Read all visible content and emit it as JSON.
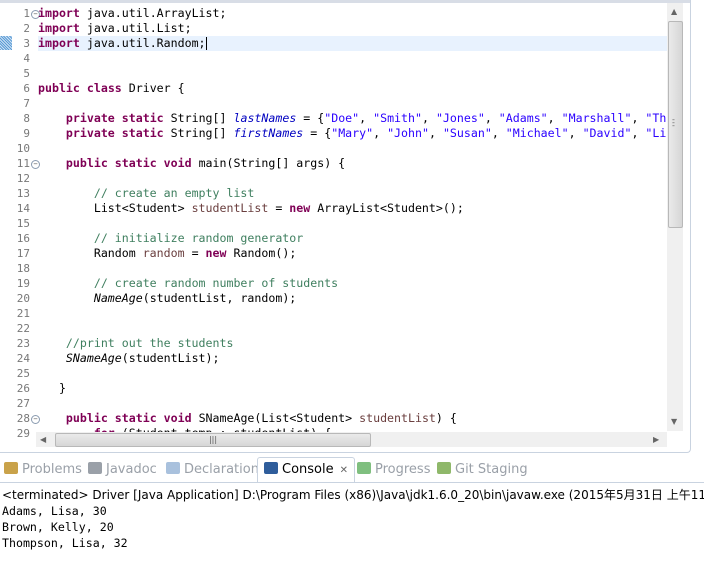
{
  "editor": {
    "line_numbers": [
      "1",
      "2",
      "3",
      "4",
      "5",
      "6",
      "7",
      "8",
      "9",
      "10",
      "11",
      "12",
      "13",
      "14",
      "15",
      "16",
      "17",
      "18",
      "19",
      "20",
      "21",
      "22",
      "23",
      "24",
      "25",
      "26",
      "27",
      "28",
      "29"
    ],
    "lines": [
      [
        [
          "k",
          "import"
        ],
        [
          "t",
          " java.util.ArrayList;"
        ]
      ],
      [
        [
          "k",
          "import"
        ],
        [
          "t",
          " java.util.List;"
        ]
      ],
      [
        [
          "k",
          "import"
        ],
        [
          "t",
          " java.util.Random;"
        ]
      ],
      [],
      [],
      [
        [
          "k",
          "public"
        ],
        [
          "t",
          " "
        ],
        [
          "k",
          "class"
        ],
        [
          "t",
          " Driver {"
        ]
      ],
      [],
      [
        [
          "t",
          "    "
        ],
        [
          "k",
          "private"
        ],
        [
          "t",
          " "
        ],
        [
          "k",
          "static"
        ],
        [
          "t",
          " String[] "
        ],
        [
          "f",
          "lastNames"
        ],
        [
          "t",
          " = {"
        ],
        [
          "s",
          "\"Doe\""
        ],
        [
          "t",
          ", "
        ],
        [
          "s",
          "\"Smith\""
        ],
        [
          "t",
          ", "
        ],
        [
          "s",
          "\"Jones\""
        ],
        [
          "t",
          ", "
        ],
        [
          "s",
          "\"Adams\""
        ],
        [
          "t",
          ", "
        ],
        [
          "s",
          "\"Marshall\""
        ],
        [
          "t",
          ", "
        ],
        [
          "s",
          "\"Th"
        ]
      ],
      [
        [
          "t",
          "    "
        ],
        [
          "k",
          "private"
        ],
        [
          "t",
          " "
        ],
        [
          "k",
          "static"
        ],
        [
          "t",
          " String[] "
        ],
        [
          "f",
          "firstNames"
        ],
        [
          "t",
          " = {"
        ],
        [
          "s",
          "\"Mary\""
        ],
        [
          "t",
          ", "
        ],
        [
          "s",
          "\"John\""
        ],
        [
          "t",
          ", "
        ],
        [
          "s",
          "\"Susan\""
        ],
        [
          "t",
          ", "
        ],
        [
          "s",
          "\"Michael\""
        ],
        [
          "t",
          ", "
        ],
        [
          "s",
          "\"David\""
        ],
        [
          "t",
          ", "
        ],
        [
          "s",
          "\"Li"
        ]
      ],
      [],
      [
        [
          "t",
          "    "
        ],
        [
          "k",
          "public"
        ],
        [
          "t",
          " "
        ],
        [
          "k",
          "static"
        ],
        [
          "t",
          " "
        ],
        [
          "k",
          "void"
        ],
        [
          "t",
          " main(String[] args) {"
        ]
      ],
      [],
      [
        [
          "t",
          "        "
        ],
        [
          "c",
          "// create an empty list"
        ]
      ],
      [
        [
          "t",
          "        List<Student> "
        ],
        [
          "v",
          "studentList"
        ],
        [
          "t",
          " = "
        ],
        [
          "k",
          "new"
        ],
        [
          "t",
          " ArrayList<Student>();"
        ]
      ],
      [],
      [
        [
          "t",
          "        "
        ],
        [
          "c",
          "// initialize random generator"
        ]
      ],
      [
        [
          "t",
          "        Random "
        ],
        [
          "v",
          "random"
        ],
        [
          "t",
          " = "
        ],
        [
          "k",
          "new"
        ],
        [
          "t",
          " Random();"
        ]
      ],
      [],
      [
        [
          "t",
          "        "
        ],
        [
          "c",
          "// create random number of students"
        ]
      ],
      [
        [
          "t",
          "        "
        ],
        [
          "i",
          "NameAge"
        ],
        [
          "t",
          "(studentList, random);"
        ]
      ],
      [],
      [],
      [
        [
          "t",
          "    "
        ],
        [
          "c",
          "//print out the students"
        ]
      ],
      [
        [
          "t",
          "    "
        ],
        [
          "i",
          "SNameAge"
        ],
        [
          "t",
          "(studentList);"
        ]
      ],
      [],
      [
        [
          "t",
          "   }"
        ]
      ],
      [],
      [
        [
          "t",
          "    "
        ],
        [
          "k",
          "public"
        ],
        [
          "t",
          " "
        ],
        [
          "k",
          "static"
        ],
        [
          "t",
          " "
        ],
        [
          "k",
          "void"
        ],
        [
          "t",
          " SNameAge(List<Student> "
        ],
        [
          "v",
          "studentList"
        ],
        [
          "t",
          ") {"
        ]
      ],
      [
        [
          "t",
          "        "
        ],
        [
          "k",
          "for"
        ],
        [
          "t",
          " (Student temp : studentList) {"
        ]
      ]
    ]
  },
  "tabs": [
    {
      "label": "Problems",
      "icon": "problems-icon",
      "color": "#c9a24a"
    },
    {
      "label": "Javadoc",
      "icon": "at-icon",
      "color": "#9aa0a8"
    },
    {
      "label": "Declaration",
      "icon": "declaration-icon",
      "color": "#a9c1dd"
    },
    {
      "label": "Console",
      "icon": "console-icon",
      "color": "#2f5d9b",
      "close": "✕"
    },
    {
      "label": "Progress",
      "icon": "progress-icon",
      "color": "#7fbf7f"
    },
    {
      "label": "Git Staging",
      "icon": "git-staging-icon",
      "color": "#8fb86a"
    }
  ],
  "console": {
    "status": "<terminated> Driver [Java Application] D:\\Program Files (x86)\\Java\\jdk1.6.0_20\\bin\\javaw.exe (2015年5月31日 上午11:38:3",
    "output": [
      "Adams, Lisa, 30",
      "Brown, Kelly, 20",
      "Thompson, Lisa, 32"
    ]
  }
}
